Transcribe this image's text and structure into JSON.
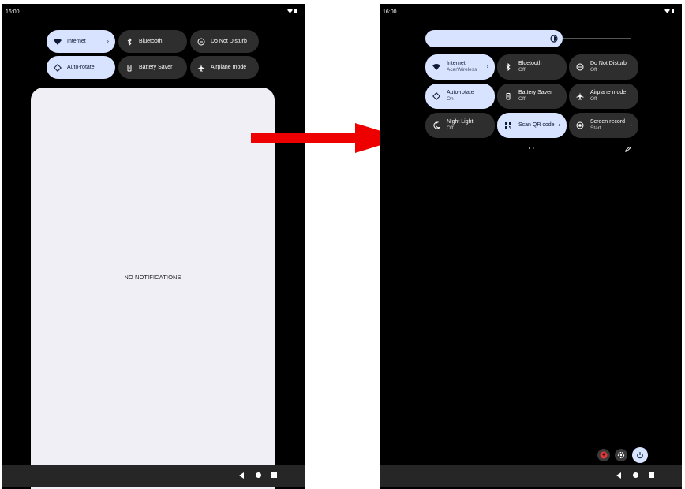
{
  "left_screen": {
    "status_time": "16:00",
    "tiles": [
      {
        "title": "Internet",
        "active": true
      },
      {
        "title": "Bluetooth",
        "active": false
      },
      {
        "title": "Do Not Disturb",
        "active": false
      },
      {
        "title": "Auto-rotate",
        "active": true
      },
      {
        "title": "Battery Saver",
        "active": false
      },
      {
        "title": "Airplane mode",
        "active": false
      }
    ],
    "no_notifications": "NO NOTIFICATIONS"
  },
  "right_screen": {
    "status_time": "16:00",
    "brightness_level": 0.55,
    "tiles": [
      {
        "title": "Internet",
        "subtitle": "AcerWireless",
        "active": true
      },
      {
        "title": "Bluetooth",
        "subtitle": "Off",
        "active": false
      },
      {
        "title": "Do Not Disturb",
        "subtitle": "Off",
        "active": false
      },
      {
        "title": "Auto-rotate",
        "subtitle": "On",
        "active": true
      },
      {
        "title": "Battery Saver",
        "subtitle": "Off",
        "active": false
      },
      {
        "title": "Airplane mode",
        "subtitle": "Off",
        "active": false
      },
      {
        "title": "Night Light",
        "subtitle": "Off",
        "active": false
      },
      {
        "title": "Scan QR code",
        "subtitle": "",
        "active": true
      },
      {
        "title": "Screen record",
        "subtitle": "Start",
        "active": false
      }
    ]
  },
  "chevron": "›",
  "colors": {
    "active_tile": "#d7e3ff",
    "inactive_tile": "#2e2e2e",
    "arrow": "#ee0000",
    "power_button": "#d7e3ff",
    "user_button": "#e03a3a"
  },
  "icons": {
    "internet": "wifi-icon",
    "bluetooth": "bluetooth-icon",
    "dnd": "do-not-disturb-icon",
    "auto_rotate": "rotate-icon",
    "battery_saver": "battery-icon",
    "airplane": "airplane-icon",
    "night_light": "moon-icon",
    "qr": "qr-code-icon",
    "screen_record": "record-icon",
    "edit": "pencil-icon",
    "user": "user-icon",
    "settings": "gear-icon",
    "power": "power-icon"
  }
}
